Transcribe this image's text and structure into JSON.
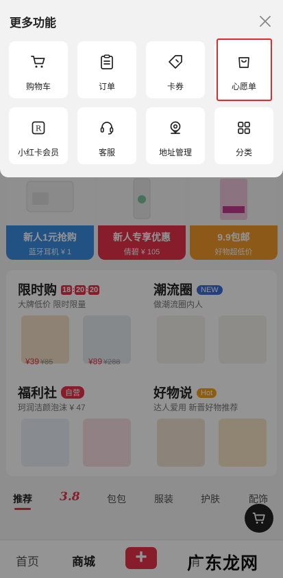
{
  "sheet": {
    "title": "更多功能",
    "items": [
      {
        "label": "购物车",
        "icon": "cart-icon"
      },
      {
        "label": "订单",
        "icon": "order-clipboard-icon"
      },
      {
        "label": "卡券",
        "icon": "coupon-tag-icon"
      },
      {
        "label": "心愿单",
        "icon": "wishlist-bag-icon"
      },
      {
        "label": "小红卡会员",
        "icon": "red-card-member-icon"
      },
      {
        "label": "客服",
        "icon": "customer-service-headset-icon"
      },
      {
        "label": "地址管理",
        "icon": "location-pin-icon"
      },
      {
        "label": "分类",
        "icon": "category-grid-icon"
      }
    ],
    "highlighted_item": "心愿单"
  },
  "promos": [
    {
      "title": "新人1元抢购",
      "sub": "蓝牙耳机 ¥ 1"
    },
    {
      "title": "新人专享优惠",
      "sub": "倩碧 ¥ 105"
    },
    {
      "title": "9.9包邮",
      "sub": "好物超低价"
    }
  ],
  "sections": {
    "flash": {
      "title": "限时购",
      "timer": [
        "18",
        "20",
        "20"
      ],
      "sub": "大牌低价 限时限量",
      "prices": [
        {
          "now": "¥39",
          "was": "¥85"
        },
        {
          "now": "¥89",
          "was": "¥288"
        }
      ]
    },
    "trend": {
      "title": "潮流圈",
      "tag": "NEW",
      "sub": "做潮流圈内人"
    },
    "welfare": {
      "title": "福利社",
      "tag": "自营",
      "sub": "珂润洁颜泡沫 ¥ 47"
    },
    "goods": {
      "title": "好物说",
      "tag": "Hot",
      "sub": "达人爱用 新晋好物推荐"
    }
  },
  "tabs": [
    "推荐",
    "3.8",
    "包包",
    "服装",
    "护肤",
    "配饰"
  ],
  "bottom_nav": {
    "home": "首页",
    "mall": "商城",
    "plus": "+",
    "partial": "消"
  },
  "watermark": "广东龙网",
  "colors": {
    "accent": "#e8334a",
    "highlight_box": "#e02b2b",
    "sheet_bg": "#f2f2f2"
  }
}
